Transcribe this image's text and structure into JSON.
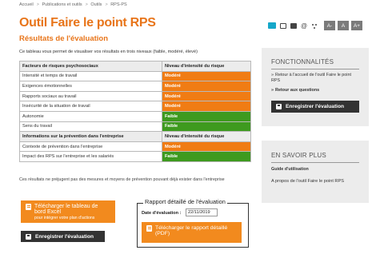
{
  "breadcrumb": [
    "Accueil",
    "Publications et outils",
    "Outils",
    "RPS-PS"
  ],
  "breadcrumb_separator": ">",
  "page_title": "Outil Faire le point RPS",
  "section_title": "Résultats de l'évaluation",
  "intro": "Ce tableau vous permet de visualiser vos résultats en trois niveaux (faible, modéré, élevé)",
  "table": {
    "header1": {
      "factor": "Facteurs de risques psychosociaux",
      "level": "Niveau d'intensité du risque"
    },
    "rows1": [
      {
        "factor": "Intensité et temps de travail",
        "level": "Modéré",
        "status": "modere"
      },
      {
        "factor": "Exigences émotionnelles",
        "level": "Modéré",
        "status": "modere"
      },
      {
        "factor": "Rapports sociaux au travail",
        "level": "Modéré",
        "status": "modere"
      },
      {
        "factor": "Insécurité de la situation de travail",
        "level": "Modéré",
        "status": "modere"
      },
      {
        "factor": "Autonomie",
        "level": "Faible",
        "status": "faible"
      },
      {
        "factor": "Sens du travail",
        "level": "Faible",
        "status": "faible"
      }
    ],
    "header2": {
      "factor": "Informations sur la prévention dans l'entreprise",
      "level": "Niveau d'intensité du risque"
    },
    "rows2": [
      {
        "factor": "Contexte de prévention dans l'entreprise",
        "level": "Modéré",
        "status": "modere"
      },
      {
        "factor": "Impact des RPS sur l'entreprise et les salariés",
        "level": "Faible",
        "status": "faible"
      }
    ]
  },
  "colors": {
    "modere": "#f07c14",
    "faible": "#3e9a1f",
    "accent": "#e8751a",
    "dark_button": "#333333"
  },
  "footnote": "Ces résultats ne préjugent pas des mesures et moyens de prévention pouvant déjà exister dans l'entreprise",
  "btn_tableau": {
    "label": "Télécharger le tableau de bord Excel",
    "sub": "pour intégrer votre plan d'actions"
  },
  "btn_save_label": "Enregistrer l'évaluation",
  "rapport": {
    "title": "Rapport détaillé de l'évaluation",
    "date_label": "Date d'évaluation :",
    "date_value": "22/11/2019",
    "btn_pdf_label": "Télécharger le rapport détaillé (PDF)"
  },
  "toolbar": {
    "icons": [
      "share-icon",
      "mail-icon",
      "print-icon",
      "at-icon",
      "dots-icon"
    ],
    "font_buttons": [
      "A-",
      "A",
      "A+"
    ]
  },
  "sidebar_func": {
    "title": "FONCTIONNALITÉS",
    "link1": "Retour à l'accueil de l'outil Faire le point RPS",
    "link2": "Retour aux questions",
    "arrow": "»",
    "save_label": "Enregistrer l'évaluation"
  },
  "sidebar_savoir": {
    "title": "EN SAVOIR PLUS",
    "guide_label": "Guide d'utilisation",
    "guide_link": "A propos de l'outil Faire le point RPS"
  }
}
